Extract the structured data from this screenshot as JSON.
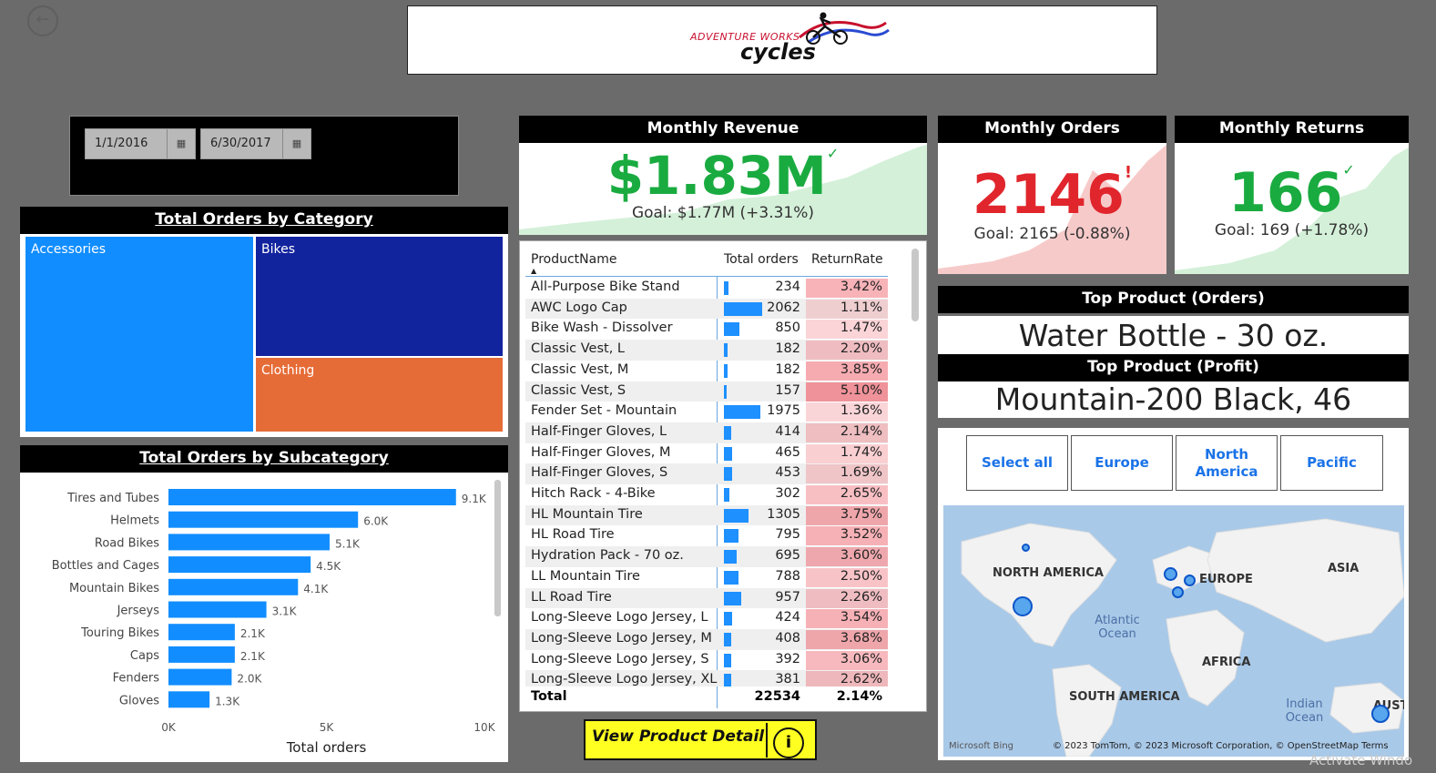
{
  "header": {
    "logo_top": "ADVENTURE WORKS",
    "logo_bottom": "cycles",
    "back_glyph": "←"
  },
  "date_slicer": {
    "start": "1/1/2016",
    "end": "6/30/2017",
    "calendar_glyph": "▦"
  },
  "treemap": {
    "title": "Total Orders by Category",
    "tiles": [
      {
        "label": "Accessories",
        "color": "#118dff"
      },
      {
        "label": "Bikes",
        "color": "#12239e"
      },
      {
        "label": "Clothing",
        "color": "#e66c37"
      }
    ]
  },
  "chart_data": {
    "type": "bar",
    "title": "Total Orders by Subcategory",
    "xlabel": "Total orders",
    "ylabel": "",
    "xlim": [
      0,
      10000
    ],
    "ticks": [
      "0K",
      "5K",
      "10K"
    ],
    "categories": [
      "Tires and Tubes",
      "Helmets",
      "Road Bikes",
      "Bottles and Cages",
      "Mountain Bikes",
      "Jerseys",
      "Touring Bikes",
      "Caps",
      "Fenders",
      "Gloves"
    ],
    "values": [
      9100,
      6000,
      5100,
      4500,
      4100,
      3100,
      2100,
      2100,
      2000,
      1300
    ],
    "labels": [
      "9.1K",
      "6.0K",
      "5.1K",
      "4.5K",
      "4.1K",
      "3.1K",
      "2.1K",
      "2.1K",
      "2.0K",
      "1.3K"
    ],
    "color": "#118dff",
    "grid": false
  },
  "kpis": {
    "revenue": {
      "title": "Monthly Revenue",
      "value": "$1.83M",
      "goal": "Goal: $1.77M (+3.31%)",
      "status": "✓",
      "color": "#1aab40",
      "fill": "#d4f0d9"
    },
    "orders": {
      "title": "Monthly Orders",
      "value": "2146",
      "goal": "Goal: 2165 (-0.88%)",
      "status": "!",
      "color": "#e0262c",
      "fill": "#f7caca"
    },
    "returns": {
      "title": "Monthly Returns",
      "value": "166",
      "goal": "Goal: 169 (+1.78%)",
      "status": "✓",
      "color": "#1aab40",
      "fill": "#d4f0d9"
    }
  },
  "table": {
    "headers": {
      "name": "ProductName",
      "orders": "Total orders",
      "rate": "ReturnRate"
    },
    "sort_glyph": "▲",
    "rows": [
      {
        "name": "All-Purpose Bike Stand",
        "orders": "234",
        "rate": "3.42%",
        "o": 234,
        "r": 3.42
      },
      {
        "name": "AWC Logo Cap",
        "orders": "2062",
        "rate": "1.11%",
        "o": 2062,
        "r": 1.11
      },
      {
        "name": "Bike Wash - Dissolver",
        "orders": "850",
        "rate": "1.47%",
        "o": 850,
        "r": 1.47
      },
      {
        "name": "Classic Vest, L",
        "orders": "182",
        "rate": "2.20%",
        "o": 182,
        "r": 2.2
      },
      {
        "name": "Classic Vest, M",
        "orders": "182",
        "rate": "3.85%",
        "o": 182,
        "r": 3.85
      },
      {
        "name": "Classic Vest, S",
        "orders": "157",
        "rate": "5.10%",
        "o": 157,
        "r": 5.1
      },
      {
        "name": "Fender Set - Mountain",
        "orders": "1975",
        "rate": "1.36%",
        "o": 1975,
        "r": 1.36
      },
      {
        "name": "Half-Finger Gloves, L",
        "orders": "414",
        "rate": "2.14%",
        "o": 414,
        "r": 2.14
      },
      {
        "name": "Half-Finger Gloves, M",
        "orders": "465",
        "rate": "1.74%",
        "o": 465,
        "r": 1.74
      },
      {
        "name": "Half-Finger Gloves, S",
        "orders": "453",
        "rate": "1.69%",
        "o": 453,
        "r": 1.69
      },
      {
        "name": "Hitch Rack - 4-Bike",
        "orders": "302",
        "rate": "2.65%",
        "o": 302,
        "r": 2.65
      },
      {
        "name": "HL Mountain Tire",
        "orders": "1305",
        "rate": "3.75%",
        "o": 1305,
        "r": 3.75
      },
      {
        "name": "HL Road Tire",
        "orders": "795",
        "rate": "3.52%",
        "o": 795,
        "r": 3.52
      },
      {
        "name": "Hydration Pack - 70 oz.",
        "orders": "695",
        "rate": "3.60%",
        "o": 695,
        "r": 3.6
      },
      {
        "name": "LL Mountain Tire",
        "orders": "788",
        "rate": "2.50%",
        "o": 788,
        "r": 2.5
      },
      {
        "name": "LL Road Tire",
        "orders": "957",
        "rate": "2.26%",
        "o": 957,
        "r": 2.26
      },
      {
        "name": "Long-Sleeve Logo Jersey, L",
        "orders": "424",
        "rate": "3.54%",
        "o": 424,
        "r": 3.54
      },
      {
        "name": "Long-Sleeve Logo Jersey, M",
        "orders": "408",
        "rate": "3.68%",
        "o": 408,
        "r": 3.68
      },
      {
        "name": "Long-Sleeve Logo Jersey, S",
        "orders": "392",
        "rate": "3.06%",
        "o": 392,
        "r": 3.06
      },
      {
        "name": "Long-Sleeve Logo Jersey, XL",
        "orders": "381",
        "rate": "2.62%",
        "o": 381,
        "r": 2.62
      }
    ],
    "total": {
      "label": "Total",
      "orders": "22534",
      "rate": "2.14%"
    }
  },
  "view_button": {
    "label": "View Product Detail",
    "info_glyph": "i"
  },
  "top_products": {
    "orders_title": "Top Product (Orders)",
    "orders_value": "Water Bottle - 30 oz.",
    "profit_title": "Top Product (Profit)",
    "profit_value": "Mountain-200 Black, 46"
  },
  "region_slicer": {
    "buttons": [
      "Select all",
      "Europe",
      "North America",
      "Pacific"
    ]
  },
  "map": {
    "labels": [
      "NORTH AMERICA",
      "EUROPE",
      "ASIA",
      "AFRICA",
      "SOUTH AMERICA",
      "AUST"
    ],
    "oceans": [
      "Atlantic Ocean",
      "Indian Ocean"
    ],
    "credit": "© 2023 TomTom, © 2023 Microsoft Corporation, © OpenStreetMap  Terms",
    "bing": "Microsoft Bing"
  },
  "watermark": "Activate Windo"
}
